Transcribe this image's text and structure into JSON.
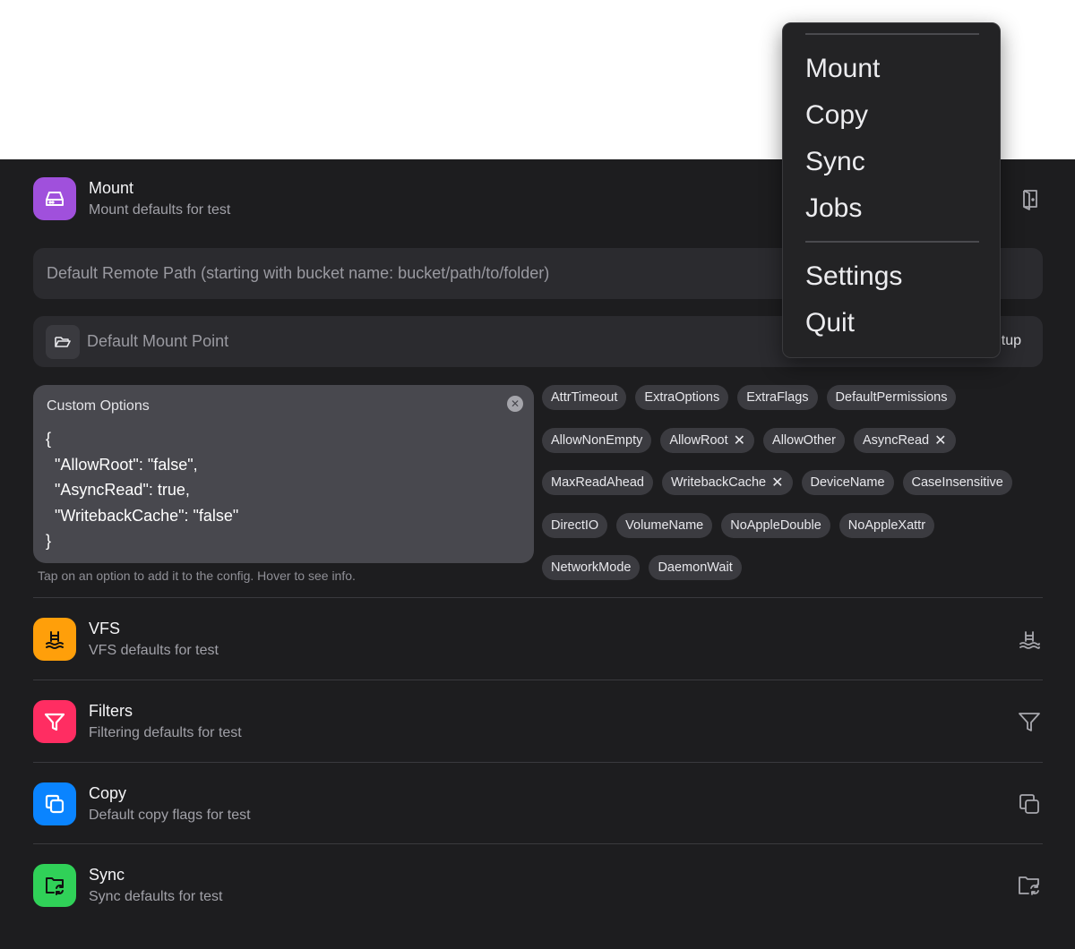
{
  "mount": {
    "title": "Mount",
    "subtitle": "Mount defaults for test",
    "remote_path_placeholder": "Default Remote Path (starting with bucket name: bucket/path/to/folder)",
    "mount_point_placeholder": "Default Mount Point",
    "setup_label": "tup",
    "custom_options_label": "Custom Options",
    "custom_options_lines": [
      "{",
      "  \"AllowRoot\": \"false\",",
      "  \"AsyncRead\": true,",
      "  \"WritebackCache\": \"false\"",
      "}"
    ],
    "hint": "Tap on an option to add it to the config. Hover to see info.",
    "option_rows": [
      [
        {
          "label": "AttrTimeout"
        },
        {
          "label": "ExtraOptions"
        },
        {
          "label": "ExtraFlags"
        },
        {
          "label": "DefaultPermissions"
        }
      ],
      [
        {
          "label": "AllowNonEmpty"
        },
        {
          "label": "AllowRoot",
          "selected": true
        },
        {
          "label": "AllowOther"
        },
        {
          "label": "AsyncRead",
          "selected": true
        }
      ],
      [
        {
          "label": "MaxReadAhead"
        },
        {
          "label": "WritebackCache",
          "selected": true
        },
        {
          "label": "DeviceName"
        },
        {
          "label": "CaseInsensitive"
        }
      ],
      [
        {
          "label": "DirectIO"
        },
        {
          "label": "VolumeName"
        },
        {
          "label": "NoAppleDouble"
        },
        {
          "label": "NoAppleXattr"
        }
      ],
      [
        {
          "label": "NetworkMode"
        },
        {
          "label": "DaemonWait"
        }
      ]
    ]
  },
  "vfs": {
    "title": "VFS",
    "subtitle": "VFS defaults for test"
  },
  "filters": {
    "title": "Filters",
    "subtitle": "Filtering defaults for test"
  },
  "copy": {
    "title": "Copy",
    "subtitle": "Default copy flags for test"
  },
  "sync": {
    "title": "Sync",
    "subtitle": "Sync defaults for test"
  },
  "menu": {
    "items": [
      "Mount",
      "Copy",
      "Sync",
      "Jobs"
    ],
    "items2": [
      "Settings",
      "Quit"
    ]
  },
  "colors": {
    "mount": "#a050dc",
    "vfs": "#ff9f0a",
    "filters": "#ff2d62",
    "copy": "#0a84ff",
    "sync": "#30d158"
  }
}
